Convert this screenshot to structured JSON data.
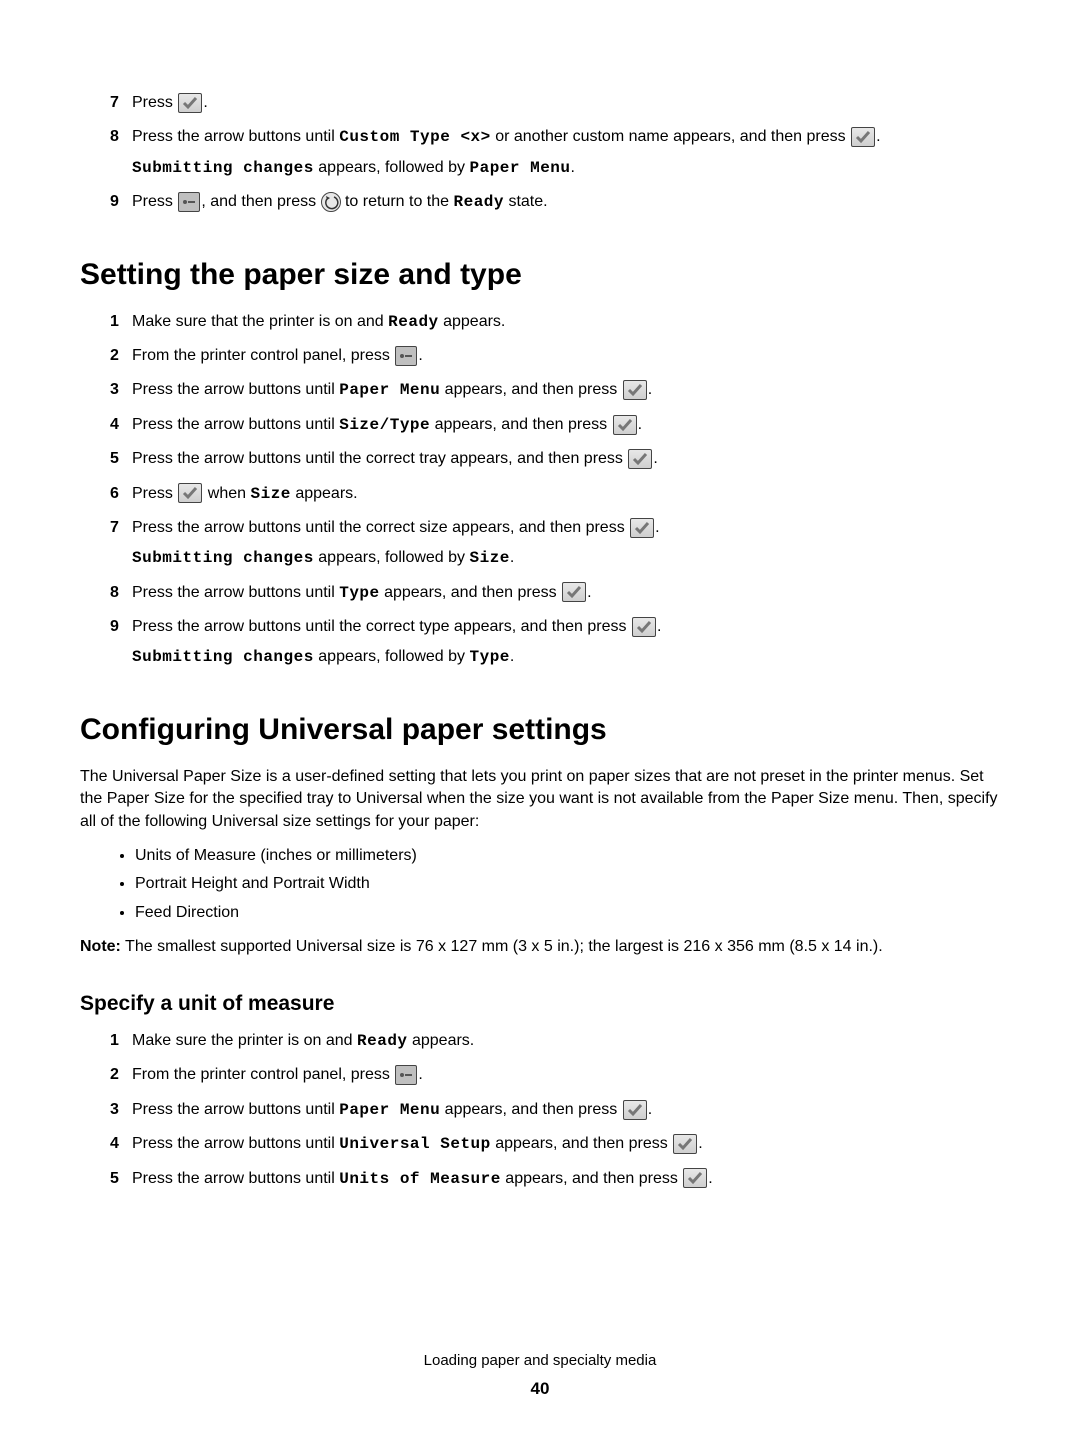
{
  "top_steps": {
    "s7": {
      "num": "7",
      "p1": "Press ",
      "p2": "."
    },
    "s8": {
      "num": "8",
      "p1": "Press the arrow buttons until ",
      "m1": "Custom Type <x>",
      "p2": " or another custom name appears, and then press ",
      "p3": ".",
      "sub_m1": "Submitting changes",
      "sub_p1": " appears, followed by ",
      "sub_m2": "Paper Menu",
      "sub_p2": "."
    },
    "s9": {
      "num": "9",
      "p1": "Press ",
      "p2": ", and then press ",
      "p3": " to return to the ",
      "m1": "Ready",
      "p4": " state."
    }
  },
  "h_setting": "Setting the paper size and type",
  "setting_steps": {
    "s1": {
      "num": "1",
      "p1": "Make sure that the printer is on and ",
      "m1": "Ready",
      "p2": " appears."
    },
    "s2": {
      "num": "2",
      "p1": "From the printer control panel, press ",
      "p2": "."
    },
    "s3": {
      "num": "3",
      "p1": "Press the arrow buttons until ",
      "m1": "Paper Menu",
      "p2": " appears, and then press ",
      "p3": "."
    },
    "s4": {
      "num": "4",
      "p1": "Press the arrow buttons until ",
      "m1": "Size/Type",
      "p2": " appears, and then press ",
      "p3": "."
    },
    "s5": {
      "num": "5",
      "p1": "Press the arrow buttons until the correct tray appears, and then press ",
      "p2": "."
    },
    "s6": {
      "num": "6",
      "p1": "Press ",
      "p2": " when ",
      "m1": "Size",
      "p3": " appears."
    },
    "s7": {
      "num": "7",
      "p1": "Press the arrow buttons until the correct size appears, and then press ",
      "p2": ".",
      "sub_m1": "Submitting changes",
      "sub_p1": " appears, followed by ",
      "sub_m2": "Size",
      "sub_p2": "."
    },
    "s8": {
      "num": "8",
      "p1": "Press the arrow buttons until ",
      "m1": "Type",
      "p2": " appears, and then press ",
      "p3": "."
    },
    "s9": {
      "num": "9",
      "p1": "Press the arrow buttons until the correct type appears, and then press ",
      "p2": ".",
      "sub_m1": "Submitting changes",
      "sub_p1": " appears, followed by ",
      "sub_m2": "Type",
      "sub_p2": "."
    }
  },
  "h_config": "Configuring Universal paper settings",
  "config_para": "The Universal Paper Size is a user-defined setting that lets you print on paper sizes that are not preset in the printer menus. Set the Paper Size for the specified tray to Universal when the size you want is not available from the Paper Size menu. Then, specify all of the following Universal size settings for your paper:",
  "bullets": {
    "b1": "Units of Measure (inches or millimeters)",
    "b2": "Portrait Height and Portrait Width",
    "b3": "Feed Direction"
  },
  "note_label": "Note:",
  "note_text": " The smallest supported Universal size is 76 x 127 mm (3  x 5 in.); the largest is 216 x 356 mm (8.5 x 14 in.).",
  "h_specify": "Specify a unit of measure",
  "specify_steps": {
    "s1": {
      "num": "1",
      "p1": "Make sure the printer is on and ",
      "m1": "Ready",
      "p2": " appears."
    },
    "s2": {
      "num": "2",
      "p1": "From the printer control panel, press ",
      "p2": "."
    },
    "s3": {
      "num": "3",
      "p1": "Press the arrow buttons until ",
      "m1": "Paper Menu",
      "p2": " appears, and then press ",
      "p3": "."
    },
    "s4": {
      "num": "4",
      "p1": "Press the arrow buttons until ",
      "m1": "Universal Setup",
      "p2": " appears, and then press ",
      "p3": "."
    },
    "s5": {
      "num": "5",
      "p1": "Press the arrow buttons until ",
      "m1": "Units of Measure",
      "p2": " appears, and then press ",
      "p3": "."
    }
  },
  "footer": "Loading paper and specialty media",
  "page_number": "40"
}
